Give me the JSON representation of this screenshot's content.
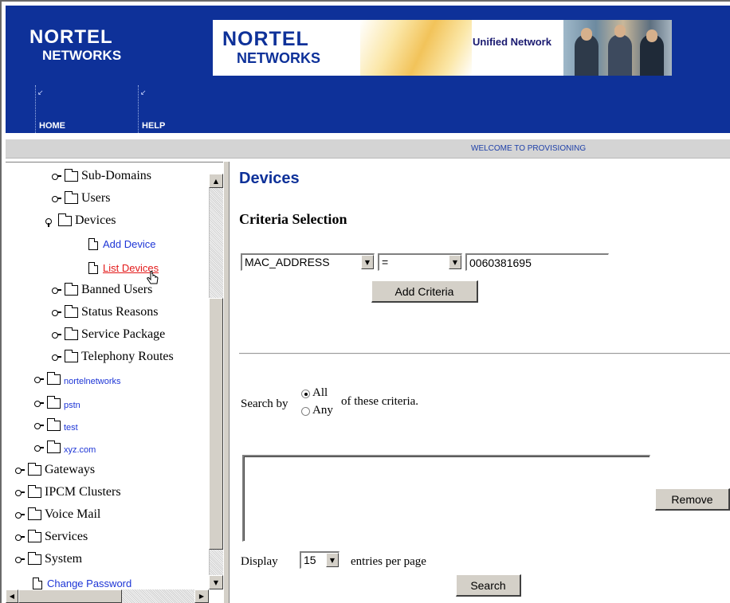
{
  "banner": {
    "logo_line1": "NORTEL",
    "logo_line2": "NETWORKS",
    "ad_logo_line1": "NORTEL",
    "ad_logo_line2": "NETWORKS",
    "ad_tagline": "Unified Network",
    "nav": [
      {
        "label": "HOME",
        "icon": "broken-image-icon"
      },
      {
        "label": "HELP",
        "icon": "broken-image-icon"
      }
    ],
    "colors": {
      "banner_bg": "#0e3199",
      "link": "#1d35d6",
      "active_link": "#e31919"
    }
  },
  "welcome_bar": {
    "text": "WELCOME TO PROVISIONING"
  },
  "tree": {
    "items": [
      {
        "label": "Sub-Domains",
        "type": "folder"
      },
      {
        "label": "Users",
        "type": "folder"
      },
      {
        "label": "Devices",
        "type": "folder",
        "expanded": true
      },
      {
        "label": "Add Device",
        "type": "page"
      },
      {
        "label": "List Devices",
        "type": "page",
        "active": true
      },
      {
        "label": "Banned Users",
        "type": "folder"
      },
      {
        "label": "Status Reasons",
        "type": "folder"
      },
      {
        "label": "Service Package",
        "type": "folder"
      },
      {
        "label": "Telephony Routes",
        "type": "folder"
      },
      {
        "label": "nortelnetworks",
        "type": "folder-link"
      },
      {
        "label": "pstn",
        "type": "folder-link"
      },
      {
        "label": "test",
        "type": "folder-link"
      },
      {
        "label": "xyz.com",
        "type": "folder-link"
      },
      {
        "label": "Gateways",
        "type": "folder"
      },
      {
        "label": "IPCM Clusters",
        "type": "folder"
      },
      {
        "label": "Voice Mail",
        "type": "folder"
      },
      {
        "label": "Services",
        "type": "folder"
      },
      {
        "label": "System",
        "type": "folder"
      },
      {
        "label": "Change Password",
        "type": "page"
      }
    ]
  },
  "content": {
    "title": "Devices",
    "criteria_heading": "Criteria Selection",
    "field_select": {
      "selected": "MAC_ADDRESS"
    },
    "operator_select": {
      "selected": "="
    },
    "value_input": {
      "value": "0060381695"
    },
    "add_criteria_label": "Add Criteria",
    "search_by_label": "Search by",
    "radio_all_label": "All",
    "radio_any_label": "Any",
    "search_by_selected": "All",
    "criteria_suffix": "of these criteria.",
    "remove_label": "Remove",
    "display_label": "Display",
    "display_select": {
      "selected": "15"
    },
    "display_suffix": "entries per page",
    "search_label": "Search"
  }
}
